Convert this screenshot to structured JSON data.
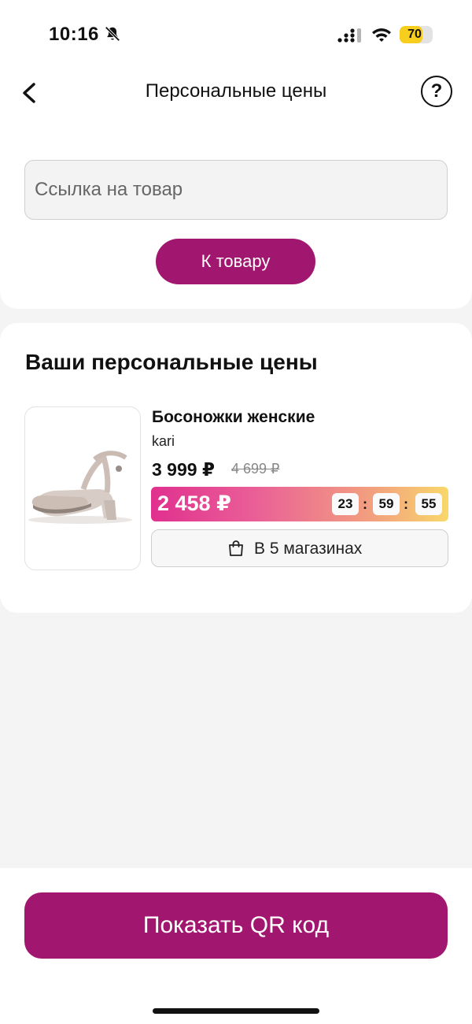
{
  "status": {
    "time": "10:16",
    "battery": "70",
    "battery_level": 0.7,
    "icons": [
      "bell-off-icon",
      "signal-icon",
      "wifi-icon",
      "battery-icon"
    ]
  },
  "nav": {
    "title": "Персональные цены",
    "help": "?",
    "icons": [
      "back-chevron-icon",
      "help-icon"
    ]
  },
  "search": {
    "placeholder": "Ссылка на товар",
    "value": "",
    "button_label": "К товару"
  },
  "prices": {
    "title": "Ваши персональные цены",
    "items": [
      {
        "name": "Босоножки женские",
        "brand": "kari",
        "price": "3 999 ₽",
        "old_price": "4 699 ₽",
        "personal_price": "2 458 ₽",
        "timer": {
          "hours": "23",
          "minutes": "59",
          "seconds": "55",
          "separator": ":"
        },
        "stores_label": "В 5 магазинах",
        "image_icon": "sandal-product-image"
      }
    ]
  },
  "bottom": {
    "qr_button_label": "Показать QR код"
  },
  "colors": {
    "brand": "#a1176f",
    "gradient_start": "#e0308e",
    "gradient_end": "#f9d86a",
    "battery": "#f7ce1d"
  }
}
